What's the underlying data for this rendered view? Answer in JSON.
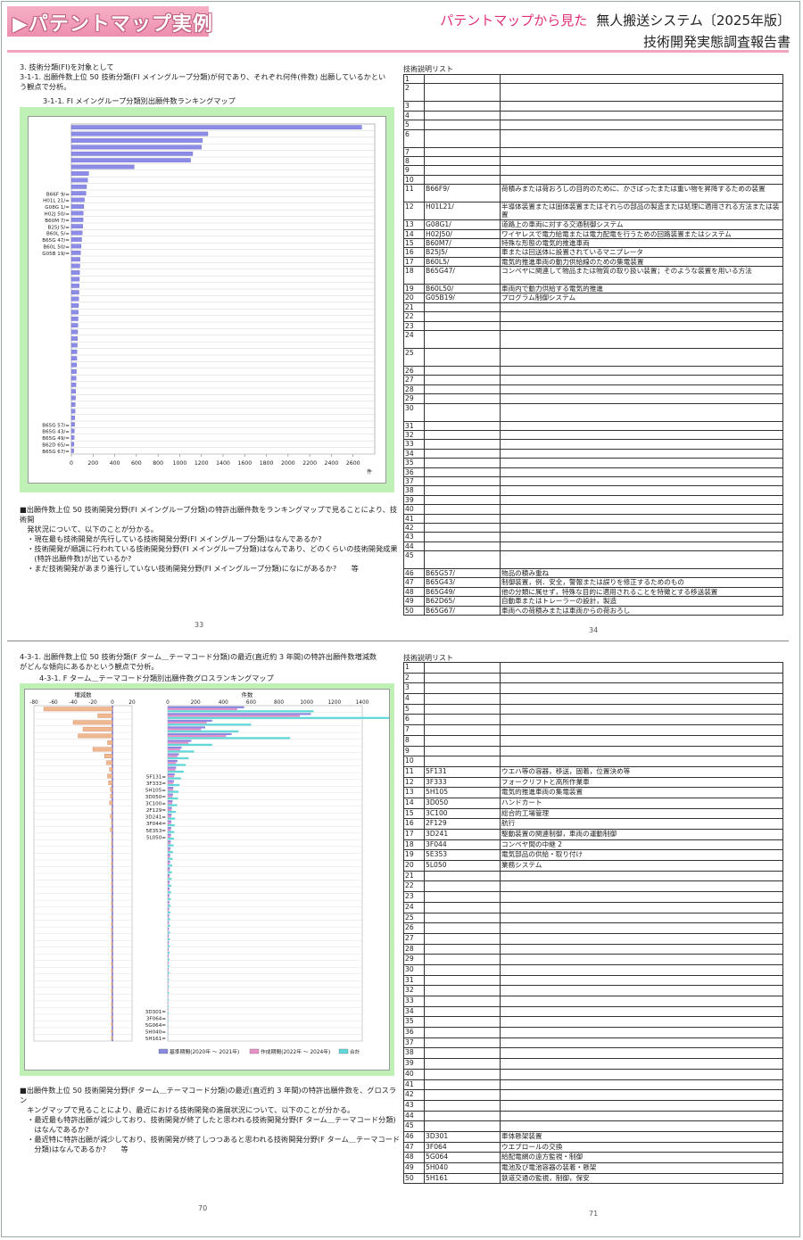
{
  "header": {
    "title": "▶パテントマップ実例",
    "subtitle_pink": "パテントマップから見た",
    "subtitle_black": "無人搬送システム〔2025年版〕",
    "subtitle2": "技術開発実態調査報告書"
  },
  "top_left": {
    "heading1": "3. 技術分類(FI)を対象として",
    "heading2": "3-1-1. 出願件数上位 50 技術分類(FI メイングループ分類)が何であり、それぞれ何件(件数) 出願しているかとい\nう観点で分析。",
    "chart_title": "3-1-1. FI メイングループ分類別出願件数ランキングマップ",
    "body": "■出願件数上位 50 技術開発分野(FI メイングループ分類)の特許出願件数をランキングマップで見ることにより、技術開\n　発状況について、以下のことが分かる。\n　・現在最も技術開発が先行している技術開発分野(FI メイングループ分類)はなんであるか?\n　・技術開発が順調に行われている技術開発分野(FI メイングループ分類)はなんであり、どのくらいの技術開発成果\n　　(特許出願件数)が出ているか?\n　・まだ技術開発があまり進行していない技術開発分野(FI メイングループ分類)になにがあるか?　　等",
    "page": "33"
  },
  "top_right": {
    "list_title": "技術説明リスト",
    "rows": [
      {
        "n": "1",
        "code": "",
        "desc": ""
      },
      {
        "n": "2",
        "code": "",
        "desc": ""
      },
      {
        "n": "3",
        "code": "",
        "desc": ""
      },
      {
        "n": "4",
        "code": "",
        "desc": ""
      },
      {
        "n": "5",
        "code": "",
        "desc": ""
      },
      {
        "n": "6",
        "code": "",
        "desc": ""
      },
      {
        "n": "7",
        "code": "",
        "desc": ""
      },
      {
        "n": "8",
        "code": "",
        "desc": ""
      },
      {
        "n": "9",
        "code": "",
        "desc": ""
      },
      {
        "n": "10",
        "code": "",
        "desc": ""
      },
      {
        "n": "11",
        "code": "B66F9/",
        "desc": "荷積みまたは荷おろしの目的のために、かさばったまたは重い物を昇降するための装置"
      },
      {
        "n": "12",
        "code": "H01L21/",
        "desc": "半導体装置または固体装置またはそれらの部品の製造または処理に適用される方法または装置"
      },
      {
        "n": "13",
        "code": "G08G1/",
        "desc": "道路上の車両に対する交通制御システム"
      },
      {
        "n": "14",
        "code": "H02J50/",
        "desc": "ワイヤレスで電力給電または電力配電を行うための回路装置またはシステム"
      },
      {
        "n": "15",
        "code": "B60M7/",
        "desc": "特殊な形態の電気的推進車両"
      },
      {
        "n": "16",
        "code": "B25J5/",
        "desc": "車または回送体に設置されているマニプレータ"
      },
      {
        "n": "17",
        "code": "B60L5/",
        "desc": "電気的推進車両の動力供給線のための集電装置"
      },
      {
        "n": "18",
        "code": "B65G47/",
        "desc": "コンベヤに関連して物品または物質の取り扱い装置；そのような装置を用いる方法"
      },
      {
        "n": "19",
        "code": "B60L50/",
        "desc": "車両内で動力供給する電気的推進"
      },
      {
        "n": "20",
        "code": "G05B19/",
        "desc": "プログラム制御システム"
      },
      {
        "n": "21",
        "code": "",
        "desc": ""
      },
      {
        "n": "22",
        "code": "",
        "desc": ""
      },
      {
        "n": "23",
        "code": "",
        "desc": ""
      },
      {
        "n": "24",
        "code": "",
        "desc": ""
      },
      {
        "n": "25",
        "code": "",
        "desc": ""
      },
      {
        "n": "26",
        "code": "",
        "desc": ""
      },
      {
        "n": "27",
        "code": "",
        "desc": ""
      },
      {
        "n": "28",
        "code": "",
        "desc": ""
      },
      {
        "n": "29",
        "code": "",
        "desc": ""
      },
      {
        "n": "30",
        "code": "",
        "desc": ""
      },
      {
        "n": "31",
        "code": "",
        "desc": ""
      },
      {
        "n": "32",
        "code": "",
        "desc": ""
      },
      {
        "n": "33",
        "code": "",
        "desc": ""
      },
      {
        "n": "34",
        "code": "",
        "desc": ""
      },
      {
        "n": "35",
        "code": "",
        "desc": ""
      },
      {
        "n": "36",
        "code": "",
        "desc": ""
      },
      {
        "n": "37",
        "code": "",
        "desc": ""
      },
      {
        "n": "38",
        "code": "",
        "desc": ""
      },
      {
        "n": "39",
        "code": "",
        "desc": ""
      },
      {
        "n": "40",
        "code": "",
        "desc": ""
      },
      {
        "n": "41",
        "code": "",
        "desc": ""
      },
      {
        "n": "42",
        "code": "",
        "desc": ""
      },
      {
        "n": "43",
        "code": "",
        "desc": ""
      },
      {
        "n": "44",
        "code": "",
        "desc": ""
      },
      {
        "n": "45",
        "code": "",
        "desc": ""
      },
      {
        "n": "46",
        "code": "B65G57/",
        "desc": "物品の積み重ね"
      },
      {
        "n": "47",
        "code": "B65G43/",
        "desc": "制御装置，例．安全，警報または誤りを修正するためのもの"
      },
      {
        "n": "48",
        "code": "B65G49/",
        "desc": "他の分類に属せず，特殊な目的に適用されることを特徴とする移送装置"
      },
      {
        "n": "49",
        "code": "B62D65/",
        "desc": "自動車またはトレーラーの設計，製造"
      },
      {
        "n": "50",
        "code": "B65G67/",
        "desc": "車両への荷積みまたは車両からの荷おろし"
      }
    ],
    "page": "34"
  },
  "bottom_left": {
    "heading1": "4-3-1. 出願件数上位 50 技術分類(F ターム＿テーマコード分類)の最近(直近約 3 年間)の特許出願件数増減数\nがどんな傾向にあるかという観点で分析。",
    "chart_title": "4-3-1. F ターム＿テーマコード分類別出願件数グロスランキングマップ",
    "body": "■出願件数上位 50 技術開発分野(F ターム＿テーマコード分類)の最近(直近約 3 年間)の特許出願件数を、グロスラン\n　キングマップで見ることにより、最近における技術開発の進展状況について、以下のことが分かる。\n　・最近最も特許出願が減少しており、技術開発が終了したと思われる技術開発分野(F ターム＿テーマコード分類)\n　　はなんであるか?\n　・最近特に特許出願が減少しており、技術開発が終了しつつあると思われる技術開発分野(F ターム＿テーマコード\n　　分類)はなんであるか?　　等",
    "page": "70"
  },
  "bottom_right": {
    "list_title": "技術説明リスト",
    "rows": [
      {
        "n": "1",
        "code": "",
        "desc": ""
      },
      {
        "n": "2",
        "code": "",
        "desc": ""
      },
      {
        "n": "3",
        "code": "",
        "desc": ""
      },
      {
        "n": "4",
        "code": "",
        "desc": ""
      },
      {
        "n": "5",
        "code": "",
        "desc": ""
      },
      {
        "n": "6",
        "code": "",
        "desc": ""
      },
      {
        "n": "7",
        "code": "",
        "desc": ""
      },
      {
        "n": "8",
        "code": "",
        "desc": ""
      },
      {
        "n": "9",
        "code": "",
        "desc": ""
      },
      {
        "n": "10",
        "code": "",
        "desc": ""
      },
      {
        "n": "11",
        "code": "5F131",
        "desc": "ウエハ等の容器，移送，固着，位置決め等"
      },
      {
        "n": "12",
        "code": "3F333",
        "desc": "フォークリフトと高所作業車"
      },
      {
        "n": "13",
        "code": "5H105",
        "desc": "電気的推進車両の集電装置"
      },
      {
        "n": "14",
        "code": "3D050",
        "desc": "ハンドカート"
      },
      {
        "n": "15",
        "code": "3C100",
        "desc": "総合的工場管理"
      },
      {
        "n": "16",
        "code": "2F129",
        "desc": "航行"
      },
      {
        "n": "17",
        "code": "3D241",
        "desc": "駆動装置の関連制御，車両の運動制御"
      },
      {
        "n": "18",
        "code": "3F044",
        "desc": "コンベヤ間の中継 2"
      },
      {
        "n": "19",
        "code": "5E353",
        "desc": "電気部品の供給・取り付け"
      },
      {
        "n": "20",
        "code": "5L050",
        "desc": "業務システム"
      },
      {
        "n": "21",
        "code": "",
        "desc": ""
      },
      {
        "n": "22",
        "code": "",
        "desc": ""
      },
      {
        "n": "23",
        "code": "",
        "desc": ""
      },
      {
        "n": "24",
        "code": "",
        "desc": ""
      },
      {
        "n": "25",
        "code": "",
        "desc": ""
      },
      {
        "n": "26",
        "code": "",
        "desc": ""
      },
      {
        "n": "27",
        "code": "",
        "desc": ""
      },
      {
        "n": "28",
        "code": "",
        "desc": ""
      },
      {
        "n": "29",
        "code": "",
        "desc": ""
      },
      {
        "n": "30",
        "code": "",
        "desc": ""
      },
      {
        "n": "31",
        "code": "",
        "desc": ""
      },
      {
        "n": "32",
        "code": "",
        "desc": ""
      },
      {
        "n": "33",
        "code": "",
        "desc": ""
      },
      {
        "n": "34",
        "code": "",
        "desc": ""
      },
      {
        "n": "35",
        "code": "",
        "desc": ""
      },
      {
        "n": "36",
        "code": "",
        "desc": ""
      },
      {
        "n": "37",
        "code": "",
        "desc": ""
      },
      {
        "n": "38",
        "code": "",
        "desc": ""
      },
      {
        "n": "39",
        "code": "",
        "desc": ""
      },
      {
        "n": "40",
        "code": "",
        "desc": ""
      },
      {
        "n": "41",
        "code": "",
        "desc": ""
      },
      {
        "n": "42",
        "code": "",
        "desc": ""
      },
      {
        "n": "43",
        "code": "",
        "desc": ""
      },
      {
        "n": "44",
        "code": "",
        "desc": ""
      },
      {
        "n": "45",
        "code": "",
        "desc": ""
      },
      {
        "n": "46",
        "code": "3D301",
        "desc": "車体懸架装置"
      },
      {
        "n": "47",
        "code": "3F064",
        "desc": "ウエブロールの交換"
      },
      {
        "n": "48",
        "code": "5G064",
        "desc": "給配電網の遠方監視・制御"
      },
      {
        "n": "49",
        "code": "5H040",
        "desc": "電池及び電池容器の装着・懸架"
      },
      {
        "n": "50",
        "code": "5H161",
        "desc": "鉄道交通の監視，制御，保安"
      }
    ],
    "page": "71"
  },
  "chart_data": [
    {
      "type": "bar",
      "orientation": "horizontal",
      "title": "3-1-1. FI メイングループ分類別出願件数ランキングマップ",
      "xlabel": "件",
      "xlim": [
        0,
        2800
      ],
      "xticks": [
        "0",
        "200",
        "400",
        "600",
        "800",
        "1000",
        "1200",
        "1400",
        "1600",
        "1800",
        "2000",
        "2200",
        "2400",
        "2600"
      ],
      "labels": [
        "",
        "",
        "",
        "",
        "",
        "",
        "",
        "",
        "",
        "",
        "B66F 9/",
        "H01L 21/",
        "G08G 1/",
        "H02J 50/",
        "B60M 7/",
        "B25J 5/",
        "B60L 5/",
        "B65G 47/",
        "B60L 50/",
        "G05B 19/",
        "",
        "",
        "",
        "",
        "",
        "",
        "",
        "",
        "",
        "",
        "",
        "",
        "",
        "",
        "",
        "",
        "",
        "",
        "",
        "",
        "",
        "",
        "",
        "",
        "",
        "B65G 57/",
        "B65G 43/",
        "B65G 49/",
        "B62D 65/",
        "B65G 67/"
      ],
      "values": [
        2680,
        1260,
        1210,
        1200,
        1120,
        1100,
        580,
        160,
        150,
        140,
        135,
        120,
        115,
        110,
        108,
        105,
        100,
        95,
        90,
        85,
        80,
        78,
        76,
        74,
        72,
        70,
        68,
        66,
        64,
        62,
        60,
        58,
        56,
        54,
        52,
        50,
        48,
        46,
        44,
        42,
        40,
        38,
        36,
        34,
        32,
        30,
        28,
        26,
        24,
        22
      ],
      "grid": true
    },
    {
      "type": "bar",
      "orientation": "horizontal",
      "title": "4-3-1. F ターム＿テーマコード分類別出願件数グロスランキングマップ",
      "panels": [
        "増減数",
        "件数"
      ],
      "diff_xlim": [
        -80,
        20
      ],
      "diff_xticks": [
        "-80",
        "-60",
        "-40",
        "-20",
        "0",
        "20"
      ],
      "count_xlim": [
        0,
        1400
      ],
      "count_xticks": [
        "0",
        "200",
        "400",
        "600",
        "800",
        "1000",
        "1200",
        "1400"
      ],
      "labels": [
        "",
        "",
        "",
        "",
        "",
        "",
        "",
        "",
        "",
        "",
        "5F131",
        "3F333",
        "5H105",
        "3D050",
        "3C100",
        "2F129",
        "3D241",
        "3F044",
        "5E353",
        "5L050",
        "",
        "",
        "",
        "",
        "",
        "",
        "",
        "",
        "",
        "",
        "",
        "",
        "",
        "",
        "",
        "",
        "",
        "",
        "",
        "",
        "",
        "",
        "",
        "",
        "",
        "3D301",
        "3F064",
        "5G064",
        "5H040",
        "5H161"
      ],
      "series": [
        {
          "name": "基準期間(2020年 〜 2021年)",
          "values": [
            550,
            1030,
            320,
            270,
            460,
            170,
            100,
            80,
            70,
            60,
            50,
            45,
            40,
            38,
            35,
            30,
            28,
            26,
            25,
            24,
            22,
            20,
            18,
            17,
            16,
            15,
            14,
            13,
            12,
            11,
            10,
            10,
            9,
            9,
            8,
            8,
            7,
            7,
            6,
            6,
            5,
            5,
            5,
            4,
            4,
            4,
            3,
            3,
            3,
            2
          ]
        },
        {
          "name": "作成期間(2022年 〜 2024年)",
          "values": [
            500,
            950,
            280,
            240,
            420,
            150,
            90,
            70,
            60,
            55,
            45,
            40,
            38,
            35,
            32,
            28,
            25,
            24,
            22,
            21,
            20,
            18,
            16,
            15,
            14,
            13,
            12,
            11,
            10,
            10,
            9,
            8,
            8,
            7,
            7,
            6,
            6,
            5,
            5,
            5,
            4,
            4,
            4,
            3,
            3,
            3,
            2,
            2,
            2,
            2
          ]
        },
        {
          "name": "合計",
          "values": [
            1050,
            1980,
            600,
            510,
            880,
            320,
            190,
            150,
            130,
            115,
            95,
            85,
            78,
            73,
            67,
            58,
            53,
            50,
            47,
            45,
            42,
            38,
            34,
            32,
            30,
            28,
            26,
            24,
            22,
            21,
            19,
            18,
            17,
            16,
            15,
            14,
            13,
            12,
            11,
            11,
            9,
            9,
            9,
            7,
            7,
            7,
            5,
            5,
            5,
            4
          ]
        }
      ],
      "diff_values": [
        -70,
        -15,
        -40,
        -30,
        -35,
        -5,
        -20,
        -8,
        -6,
        -3,
        -5,
        -4,
        -2,
        -2,
        -3,
        -1,
        -2,
        -1,
        -2,
        -1,
        -1,
        -1,
        -1,
        -1,
        -1,
        -1,
        -1,
        -1,
        -1,
        -1,
        -1,
        -1,
        -1,
        -1,
        -1,
        -1,
        -1,
        -1,
        -1,
        -1,
        -1,
        -1,
        -1,
        -1,
        -1,
        -1,
        -1,
        -1,
        -1,
        -1
      ],
      "colors": {
        "base": "#8a8ae0",
        "create": "#e890c8",
        "total": "#60d8d8",
        "diff": "#f0b890"
      }
    }
  ]
}
